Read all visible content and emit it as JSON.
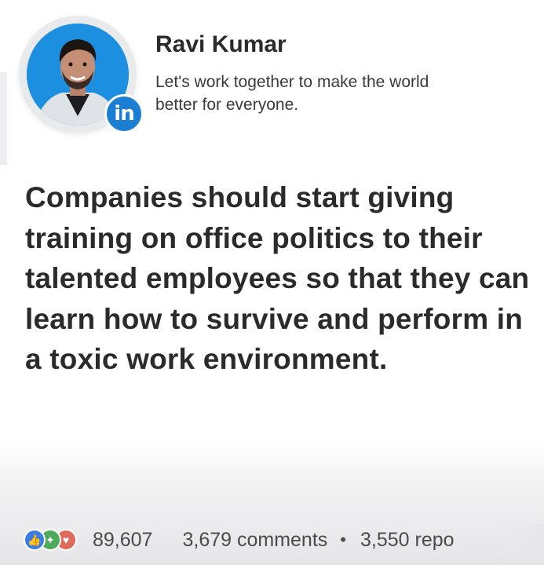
{
  "author": {
    "name": "Ravi Kumar",
    "headline": "Let's work together to make the world better for everyone.",
    "badge": "in"
  },
  "post": {
    "text": "Companies should start giving training on office politics to their talented employees so that they can learn how to survive and perform in a toxic work environment."
  },
  "engagement": {
    "reaction_icons": [
      "like-icon",
      "celebrate-icon",
      "love-icon"
    ],
    "reaction_count": "89,607",
    "comments": "3,679 comments",
    "separator": "•",
    "reposts": "3,550 repo"
  },
  "colors": {
    "linkedin_blue": "#1a7ed3",
    "avatar_bg": "#1d8fe0",
    "text_dark": "#2b2b2b"
  }
}
